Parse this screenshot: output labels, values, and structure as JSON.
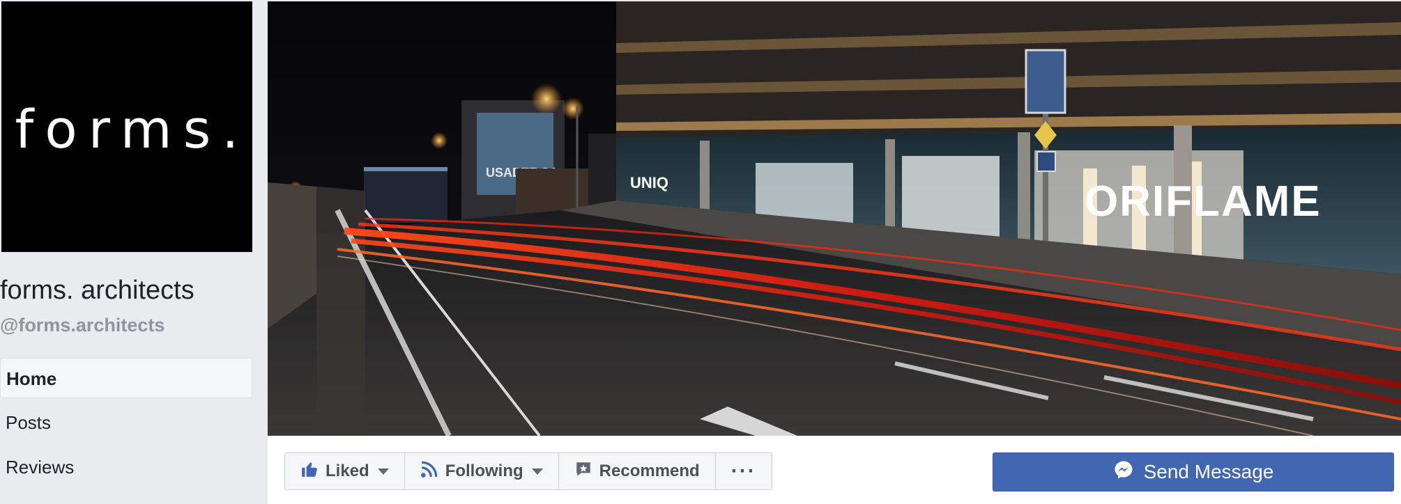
{
  "profile": {
    "logo_text": "forms.",
    "name": "forms. architects",
    "handle": "@forms.architects"
  },
  "nav": {
    "items": [
      {
        "label": "Home",
        "active": true
      },
      {
        "label": "Posts",
        "active": false
      },
      {
        "label": "Reviews",
        "active": false
      }
    ]
  },
  "cover": {
    "signs": {
      "uniq": "UNIQ",
      "oriflame": "ORIFLAME",
      "billboard": "USADTE SA"
    }
  },
  "actions": {
    "liked_label": "Liked",
    "following_label": "Following",
    "recommend_label": "Recommend",
    "more_label": "···",
    "send_message_label": "Send Message"
  },
  "colors": {
    "brand_blue": "#4267b2",
    "page_bg": "#e9ebee",
    "secondary_text": "#90949c"
  }
}
